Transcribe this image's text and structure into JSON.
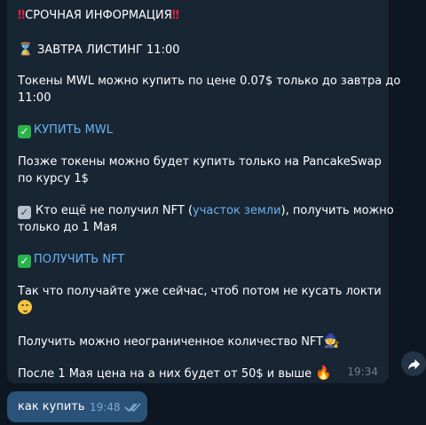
{
  "incoming": {
    "line1": "СРОЧНАЯ ИНФОРМАЦИЯ",
    "line2": "ЗАВТРА ЛИСТИНГ 11:00",
    "line3a": "Токены MWL можно купить по цене 0.07$ только до завтра до",
    "line3b": "11:00",
    "buy_link": "КУПИТЬ MWL",
    "line4a": "Позже токены можно будет купить только на PancakeSwap",
    "line4b": "по курсу 1$",
    "line5_pre": "Кто ещё не получил NFT (",
    "land_link": "участок земли",
    "line5_post": "), получить можно",
    "line5b": "только до 1 Мая",
    "get_link": "ПОЛУЧИТЬ NFT",
    "line6": "Так что получайте уже сейчас, чтоб потом не кусать локти",
    "line7": "Получить можно неограниченное количество NFT",
    "line8": "После 1 Мая цена на а них будет от 50$ и выше",
    "time": "19:34"
  },
  "outgoing": {
    "text": "как купить",
    "time": "19:48"
  },
  "icons": {
    "alarm": "double-exclamation-icon",
    "hourglass": "hourglass-icon",
    "check_green": "check-mark-button-icon",
    "check_grey": "check-box-icon",
    "smirk": "smirking-face-icon",
    "wizard": "mage-icon",
    "fire": "fire-icon",
    "share": "share-arrow-icon",
    "read": "double-check-icon"
  },
  "colors": {
    "background": "#0e1621",
    "incoming_bubble": "#182533",
    "outgoing_bubble": "#2b5278",
    "link": "#6ab2f2",
    "alarm_red": "#e0243a"
  }
}
